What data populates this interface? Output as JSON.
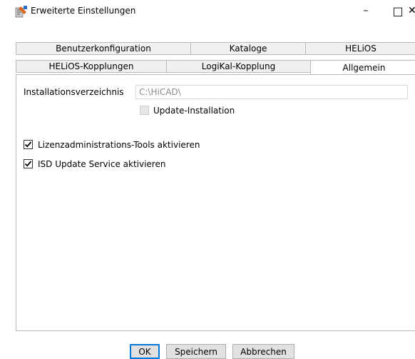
{
  "window": {
    "title": "Erweiterte Einstellungen",
    "controls": {
      "minimize": "–",
      "maximize": "□",
      "close": "✕"
    }
  },
  "tabs": {
    "row1": [
      {
        "label": "Benutzerkonfiguration"
      },
      {
        "label": "Kataloge"
      },
      {
        "label": "HELiOS"
      }
    ],
    "row2": [
      {
        "label": "HELiOS-Kopplungen"
      },
      {
        "label": "LogiKal-Kopplung"
      },
      {
        "label": "Allgemein",
        "active": true
      }
    ]
  },
  "general": {
    "install_dir_label": "Installationsverzeichnis",
    "install_dir_value": "C:\\HiCAD\\",
    "update_install": {
      "label": "Update-Installation",
      "checked": false,
      "enabled": false
    },
    "license_tools": {
      "label": "Lizenzadministrations-Tools aktivieren",
      "checked": true
    },
    "isd_update": {
      "label": "ISD Update Service aktivieren",
      "checked": true
    }
  },
  "buttons": {
    "ok": "OK",
    "save": "Speichern",
    "cancel": "Abbrechen"
  },
  "colors": {
    "tab_border": "#b9b9b9",
    "tab_bg": "#f0f0f0",
    "button_default_border": "#0078d7"
  }
}
